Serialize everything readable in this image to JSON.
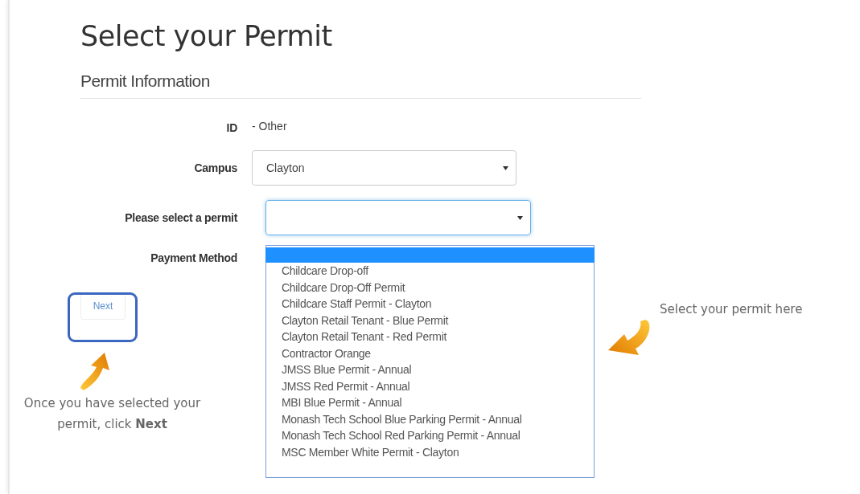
{
  "title": "Select your Permit",
  "section_title": "Permit Information",
  "fields": [
    {
      "kind": "text",
      "label": "ID",
      "value": "- Other"
    },
    {
      "kind": "select",
      "label": "Campus",
      "value": "Clayton",
      "focused": false
    },
    {
      "kind": "select",
      "label": "Please select a permit",
      "focused": true
    },
    {
      "kind": "empty",
      "label": "Payment Method"
    }
  ],
  "next_button": {
    "label": "Next",
    "disabled": true,
    "highlighted": true
  },
  "permit_dropdown": {
    "blank_row_highlighted": true,
    "options": [
      {
        "label": "Childcare Drop-off",
        "selected": false
      },
      {
        "label": "Childcare Drop-Off Permit",
        "selected": false
      },
      {
        "label": "Childcare Staff Permit - Clayton",
        "selected": false
      },
      {
        "label": "Clayton Retail Tenant - Blue Permit",
        "selected": false
      },
      {
        "label": "Clayton Retail Tenant - Red Permit",
        "selected": false
      },
      {
        "label": "Contractor Orange",
        "selected": false
      },
      {
        "label": "JMSS Blue Permit - Annual",
        "selected": false
      },
      {
        "label": "JMSS Red Permit - Annual",
        "selected": false
      },
      {
        "label": "MBI Blue Permit - Annual",
        "selected": false
      },
      {
        "label": "Monash Tech School Blue Parking Permit - Annual",
        "selected": false
      },
      {
        "label": "Monash Tech School Red Parking Permit - Annual",
        "selected": false
      },
      {
        "label": "MSC Member White Permit - Clayton",
        "selected": false
      }
    ]
  },
  "annotations": [
    {
      "kind": "up",
      "text": "Once you have selected your permit, click **Next**"
    },
    {
      "kind": "down-left",
      "text": "Select your permit here"
    }
  ]
}
